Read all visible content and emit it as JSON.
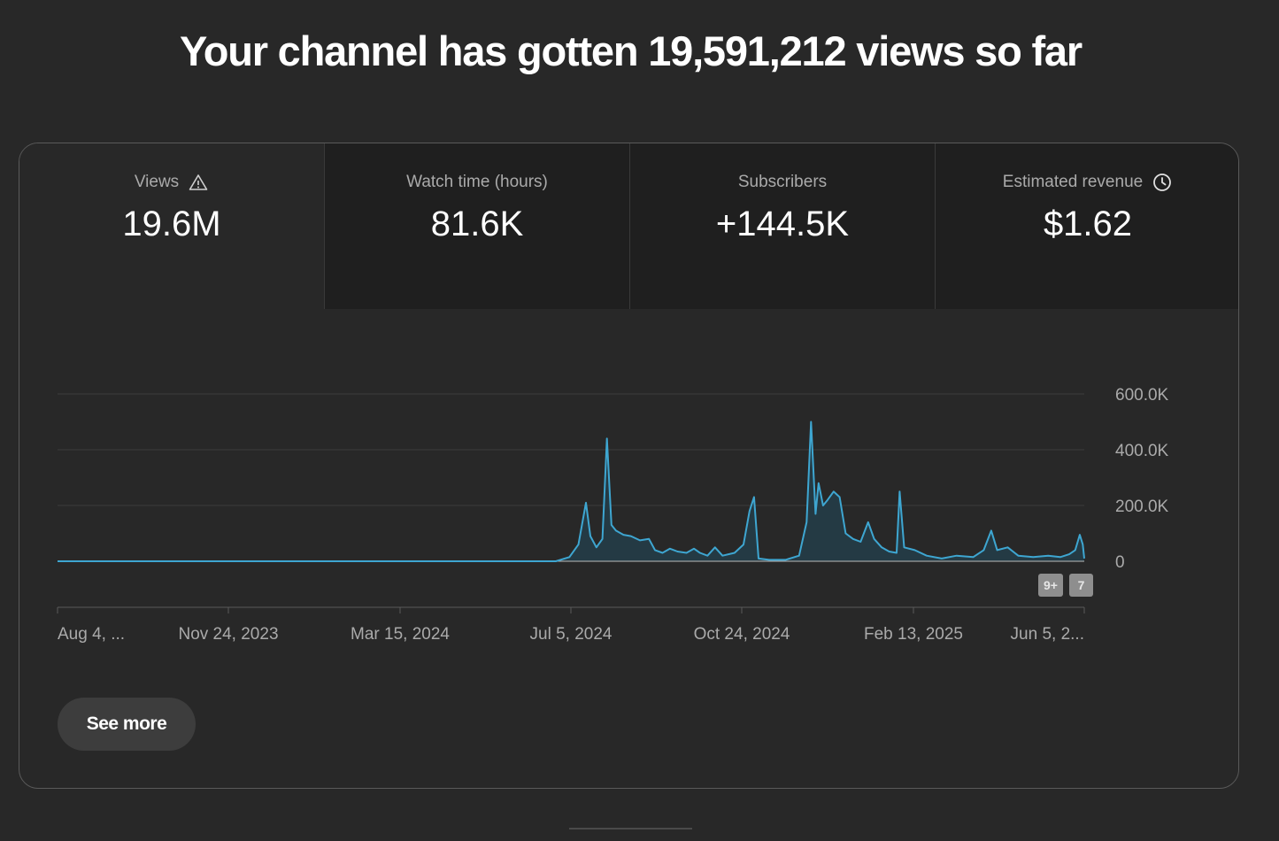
{
  "headline": "Your channel has gotten 19,591,212 views so far",
  "metrics": [
    {
      "label": "Views",
      "value": "19.6M",
      "icon": "warning-icon",
      "active": true
    },
    {
      "label": "Watch time (hours)",
      "value": "81.6K",
      "icon": null,
      "active": false
    },
    {
      "label": "Subscribers",
      "value": "+144.5K",
      "icon": null,
      "active": false
    },
    {
      "label": "Estimated revenue",
      "value": "$1.62",
      "icon": "clock-icon",
      "active": false
    }
  ],
  "see_more_label": "See more",
  "badges": [
    "9+",
    "7"
  ],
  "colors": {
    "line": "#3ea6d1",
    "fill": "#243a44",
    "background": "#282828",
    "tab_inactive": "#1f1f1f"
  },
  "chart_data": {
    "type": "area",
    "x_tick_labels": [
      "Aug 4, ...",
      "Nov 24, 2023",
      "Mar 15, 2024",
      "Jul 5, 2024",
      "Oct 24, 2024",
      "Feb 13, 2025",
      "Jun 5, 2..."
    ],
    "y_tick_labels": [
      "600.0K",
      "400.0K",
      "200.0K",
      "0"
    ],
    "y_ticks": [
      600000,
      400000,
      200000,
      0
    ],
    "ylim": [
      0,
      600000
    ],
    "xlim": [
      "2023-08-04",
      "2025-06-18"
    ],
    "grid": true,
    "series": [
      {
        "values": [
          [
            "2023-08-04",
            0
          ],
          [
            "2024-07-01",
            0
          ],
          [
            "2024-07-10",
            15000
          ],
          [
            "2024-07-16",
            60000
          ],
          [
            "2024-07-21",
            210000
          ],
          [
            "2024-07-24",
            90000
          ],
          [
            "2024-07-28",
            50000
          ],
          [
            "2024-08-01",
            80000
          ],
          [
            "2024-08-04",
            440000
          ],
          [
            "2024-08-07",
            130000
          ],
          [
            "2024-08-10",
            110000
          ],
          [
            "2024-08-15",
            95000
          ],
          [
            "2024-08-20",
            90000
          ],
          [
            "2024-08-26",
            75000
          ],
          [
            "2024-09-01",
            80000
          ],
          [
            "2024-09-05",
            40000
          ],
          [
            "2024-09-10",
            30000
          ],
          [
            "2024-09-15",
            45000
          ],
          [
            "2024-09-20",
            35000
          ],
          [
            "2024-09-26",
            30000
          ],
          [
            "2024-10-01",
            45000
          ],
          [
            "2024-10-05",
            30000
          ],
          [
            "2024-10-10",
            20000
          ],
          [
            "2024-10-15",
            50000
          ],
          [
            "2024-10-20",
            20000
          ],
          [
            "2024-10-28",
            30000
          ],
          [
            "2024-11-03",
            60000
          ],
          [
            "2024-11-07",
            180000
          ],
          [
            "2024-11-10",
            230000
          ],
          [
            "2024-11-13",
            10000
          ],
          [
            "2024-11-20",
            5000
          ],
          [
            "2024-12-01",
            5000
          ],
          [
            "2024-12-10",
            20000
          ],
          [
            "2024-12-15",
            140000
          ],
          [
            "2024-12-18",
            500000
          ],
          [
            "2024-12-21",
            170000
          ],
          [
            "2024-12-23",
            280000
          ],
          [
            "2024-12-26",
            200000
          ],
          [
            "2024-12-29",
            220000
          ],
          [
            "2025-01-02",
            250000
          ],
          [
            "2025-01-06",
            230000
          ],
          [
            "2025-01-10",
            100000
          ],
          [
            "2025-01-15",
            80000
          ],
          [
            "2025-01-20",
            70000
          ],
          [
            "2025-01-25",
            140000
          ],
          [
            "2025-01-29",
            80000
          ],
          [
            "2025-02-03",
            50000
          ],
          [
            "2025-02-08",
            35000
          ],
          [
            "2025-02-13",
            30000
          ],
          [
            "2025-02-15",
            250000
          ],
          [
            "2025-02-18",
            50000
          ],
          [
            "2025-02-25",
            40000
          ],
          [
            "2025-03-05",
            20000
          ],
          [
            "2025-03-15",
            10000
          ],
          [
            "2025-03-25",
            20000
          ],
          [
            "2025-04-05",
            15000
          ],
          [
            "2025-04-12",
            40000
          ],
          [
            "2025-04-17",
            110000
          ],
          [
            "2025-04-21",
            40000
          ],
          [
            "2025-04-28",
            50000
          ],
          [
            "2025-05-05",
            20000
          ],
          [
            "2025-05-15",
            15000
          ],
          [
            "2025-05-25",
            20000
          ],
          [
            "2025-06-02",
            15000
          ],
          [
            "2025-06-08",
            25000
          ],
          [
            "2025-06-12",
            40000
          ],
          [
            "2025-06-15",
            95000
          ],
          [
            "2025-06-17",
            60000
          ],
          [
            "2025-06-18",
            10000
          ]
        ]
      }
    ]
  }
}
